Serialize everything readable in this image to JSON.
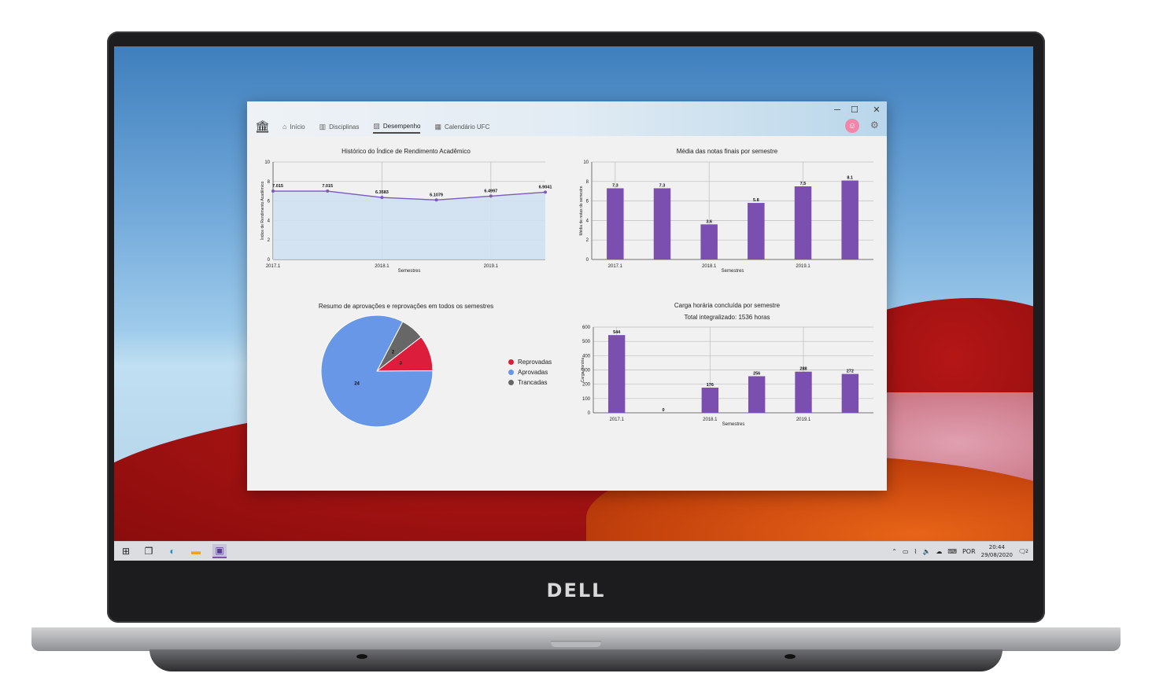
{
  "laptop": {
    "brand": "DELL"
  },
  "window": {
    "controls": {
      "minimize": "─",
      "maximize": "☐",
      "close": "✕"
    },
    "nav": {
      "logo_icon": "university-icon",
      "items": [
        {
          "label": "Início",
          "icon": "home-icon"
        },
        {
          "label": "Disciplinas",
          "icon": "books-icon"
        },
        {
          "label": "Desempenho",
          "icon": "chart-icon",
          "active": true
        },
        {
          "label": "Calendário UFC",
          "icon": "calendar-icon"
        }
      ]
    },
    "user": {
      "avatar_icon": "user-avatar-icon",
      "settings_icon": "gear-icon"
    }
  },
  "taskbar": {
    "apps": [
      "windows-start-icon",
      "task-view-icon",
      "edge-icon",
      "file-explorer-icon",
      "app-icon"
    ],
    "tray": {
      "language": "POR",
      "time": "20:44",
      "date": "29/08/2020",
      "notification_count": "2"
    }
  },
  "chart_data": [
    {
      "type": "area",
      "title": "Histórico do Índice de Rendimento Acadêmico",
      "xlabel": "Semestres",
      "ylabel": "Índice de Rendimento Acadêmico",
      "x_ticks": [
        "2017.1",
        "2018.1",
        "2019.1"
      ],
      "ylim": [
        0,
        10
      ],
      "y_ticks": [
        0,
        2,
        4,
        6,
        8,
        10
      ],
      "grid": true,
      "values": [
        7.015,
        7.015,
        6.3583,
        6.1079,
        6.4997,
        6.9041
      ],
      "labels": [
        "7.015",
        "7.015",
        "6.3583",
        "6.1079",
        "6.4997",
        "6.9041"
      ],
      "color": "#7b5ab8",
      "fill": "#cfe1f1"
    },
    {
      "type": "bar",
      "title": "Média das notas finais por semestre",
      "xlabel": "Semestres",
      "ylabel": "Média de notas do semestre",
      "x_ticks": [
        "2017.1",
        "2018.1",
        "2019.1"
      ],
      "ylim": [
        0,
        10
      ],
      "y_ticks": [
        0,
        2,
        4,
        6,
        8,
        10
      ],
      "grid": true,
      "values": [
        7.3,
        7.3,
        3.6,
        5.8,
        7.5,
        8.1
      ],
      "labels": [
        "7.3",
        "7.3",
        "3.6",
        "5.8",
        "7.5",
        "8.1"
      ],
      "color": "#7a4fb0"
    },
    {
      "type": "pie",
      "title": "Resumo de aprovações e reprovações em todos os semestres",
      "slices": [
        {
          "name": "Reprovadas",
          "value": 3,
          "color": "#dc1e3c"
        },
        {
          "name": "Aprovadas",
          "value": 24,
          "color": "#6897e8"
        },
        {
          "name": "Trancadas",
          "value": 2,
          "color": "#676767"
        }
      ],
      "legend": "right"
    },
    {
      "type": "bar",
      "title": "Carga horária concluída por semestre",
      "subtitle": "Total integralizado: 1536 horas",
      "xlabel": "Semestres",
      "ylabel": "Carga Horária",
      "x_ticks": [
        "2017.1",
        "2018.1",
        "2019.1"
      ],
      "ylim": [
        0,
        600
      ],
      "y_ticks": [
        0,
        100,
        200,
        300,
        400,
        500,
        600
      ],
      "grid": true,
      "values": [
        544,
        0,
        176,
        256,
        288,
        272
      ],
      "labels": [
        "544",
        "0",
        "176",
        "256",
        "288",
        "272"
      ],
      "color": "#7a4fb0"
    }
  ]
}
